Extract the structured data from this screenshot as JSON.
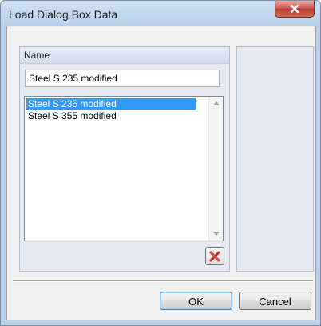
{
  "window": {
    "title": "Load Dialog Box Data"
  },
  "name_section": {
    "header": "Name",
    "input_value": "Steel S 235 modified"
  },
  "list": {
    "items": [
      {
        "label": "Steel S 235 modified",
        "selected": true
      },
      {
        "label": "Steel S 355 modified",
        "selected": false
      }
    ]
  },
  "buttons": {
    "ok": "OK",
    "cancel": "Cancel"
  },
  "colors": {
    "selection": "#3399ff",
    "close_button": "#c75050",
    "panel_bg": "#e6e9f2"
  }
}
